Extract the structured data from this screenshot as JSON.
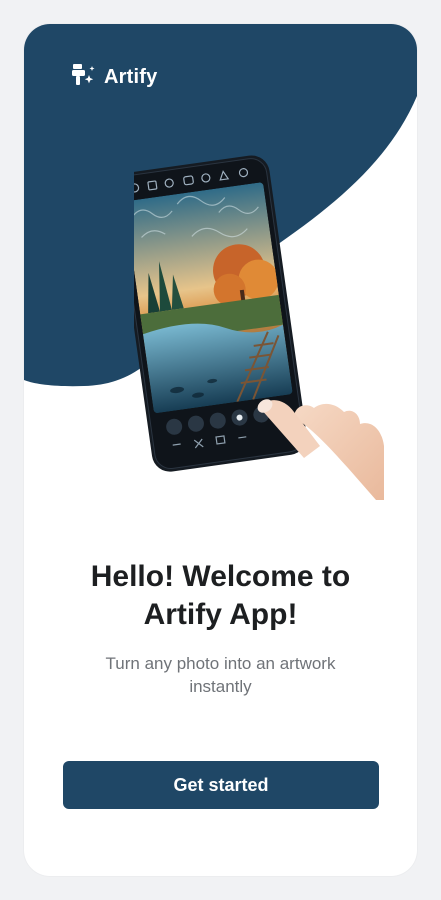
{
  "app": {
    "name": "Artify",
    "logo_icon": "paint-brush-sparkle-icon"
  },
  "welcome": {
    "title_line1": "Hello! Welcome to",
    "title_line2": "Artify App!",
    "subtitle_line1": "Turn any photo into an artwork",
    "subtitle_line2": "instantly"
  },
  "actions": {
    "get_started_label": "Get started"
  },
  "colors": {
    "brand": "#1f4766",
    "background": "#ffffff",
    "text": "#1d1f21",
    "muted": "#6f7378"
  }
}
